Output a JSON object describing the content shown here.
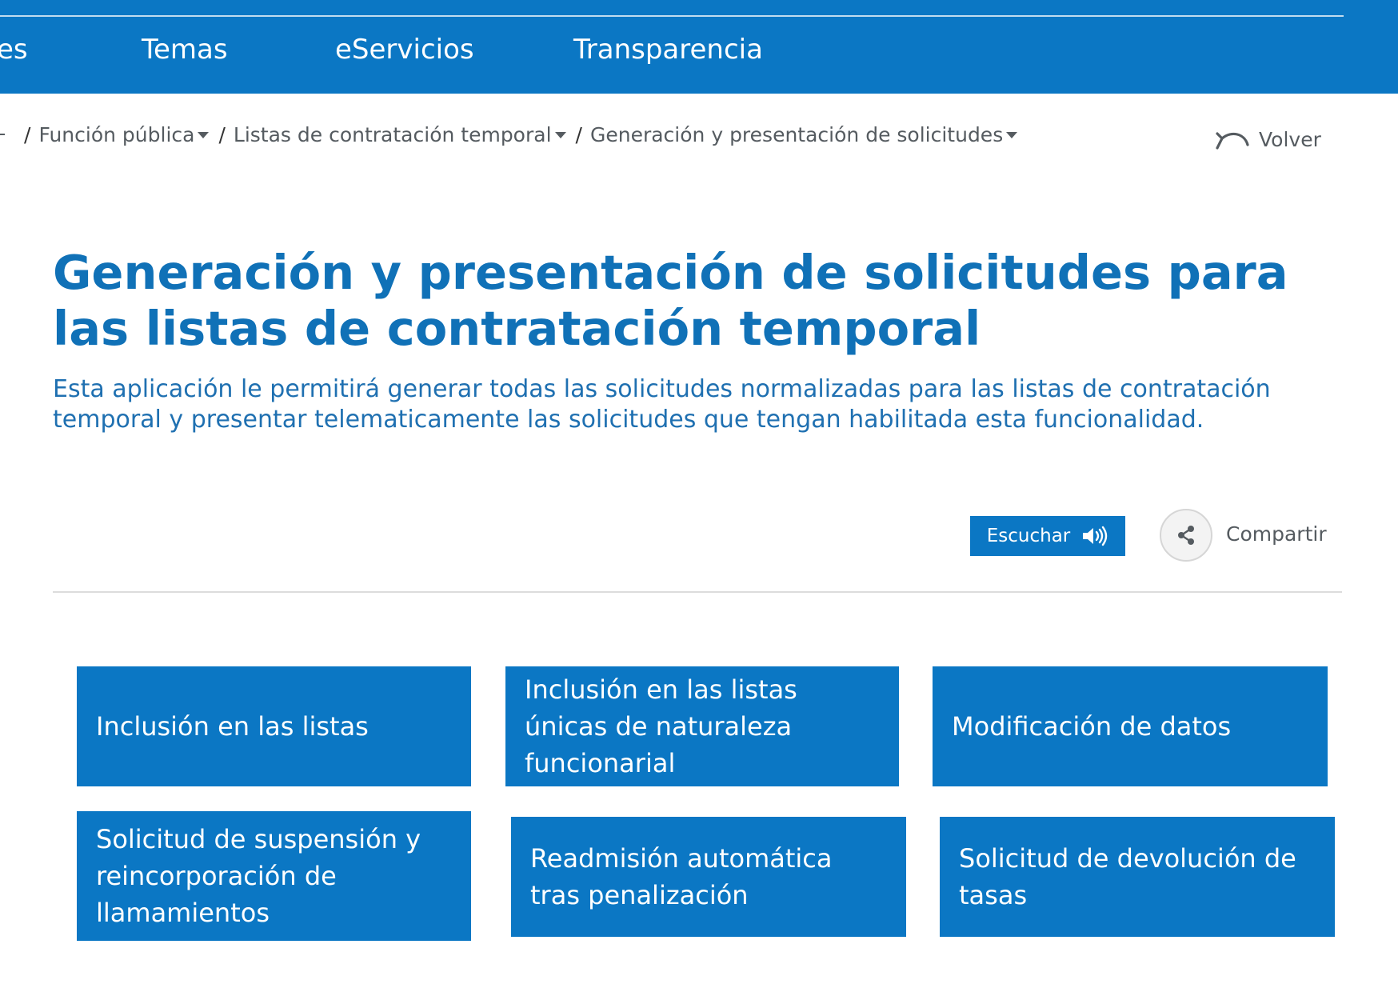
{
  "topnav": {
    "items": [
      "es",
      "Temas",
      "eServicios",
      "Transparencia"
    ]
  },
  "breadcrumb": {
    "items": [
      {
        "label": "Función pública"
      },
      {
        "label": "Listas de contratación temporal"
      },
      {
        "label": "Generación y presentación de solicitudes"
      }
    ],
    "separator": "/"
  },
  "back": {
    "label": "Volver"
  },
  "page": {
    "title": "Generación y presentación de solicitudes para las listas de contratación temporal",
    "intro": "Esta aplicación le permitirá generar todas las solicitudes normalizadas para las listas de contratación temporal y presentar telematicamente las solicitudes que tengan habilitada esta funcionalidad."
  },
  "actions": {
    "listen_label": "Escuchar",
    "share_label": "Compartir"
  },
  "tiles": [
    {
      "label": "Inclusión en las listas"
    },
    {
      "label": "Inclusión en las listas únicas de naturaleza funcionarial"
    },
    {
      "label": "Modificación de datos"
    },
    {
      "label": "Solicitud de suspensión y reincorporación de llamamientos"
    },
    {
      "label": "Readmisión automática tras penalización"
    },
    {
      "label": "Solicitud de devolución de tasas"
    }
  ],
  "colors": {
    "brand_blue": "#0b77c4",
    "title_blue": "#1071b7",
    "muted_text": "#555b60"
  }
}
